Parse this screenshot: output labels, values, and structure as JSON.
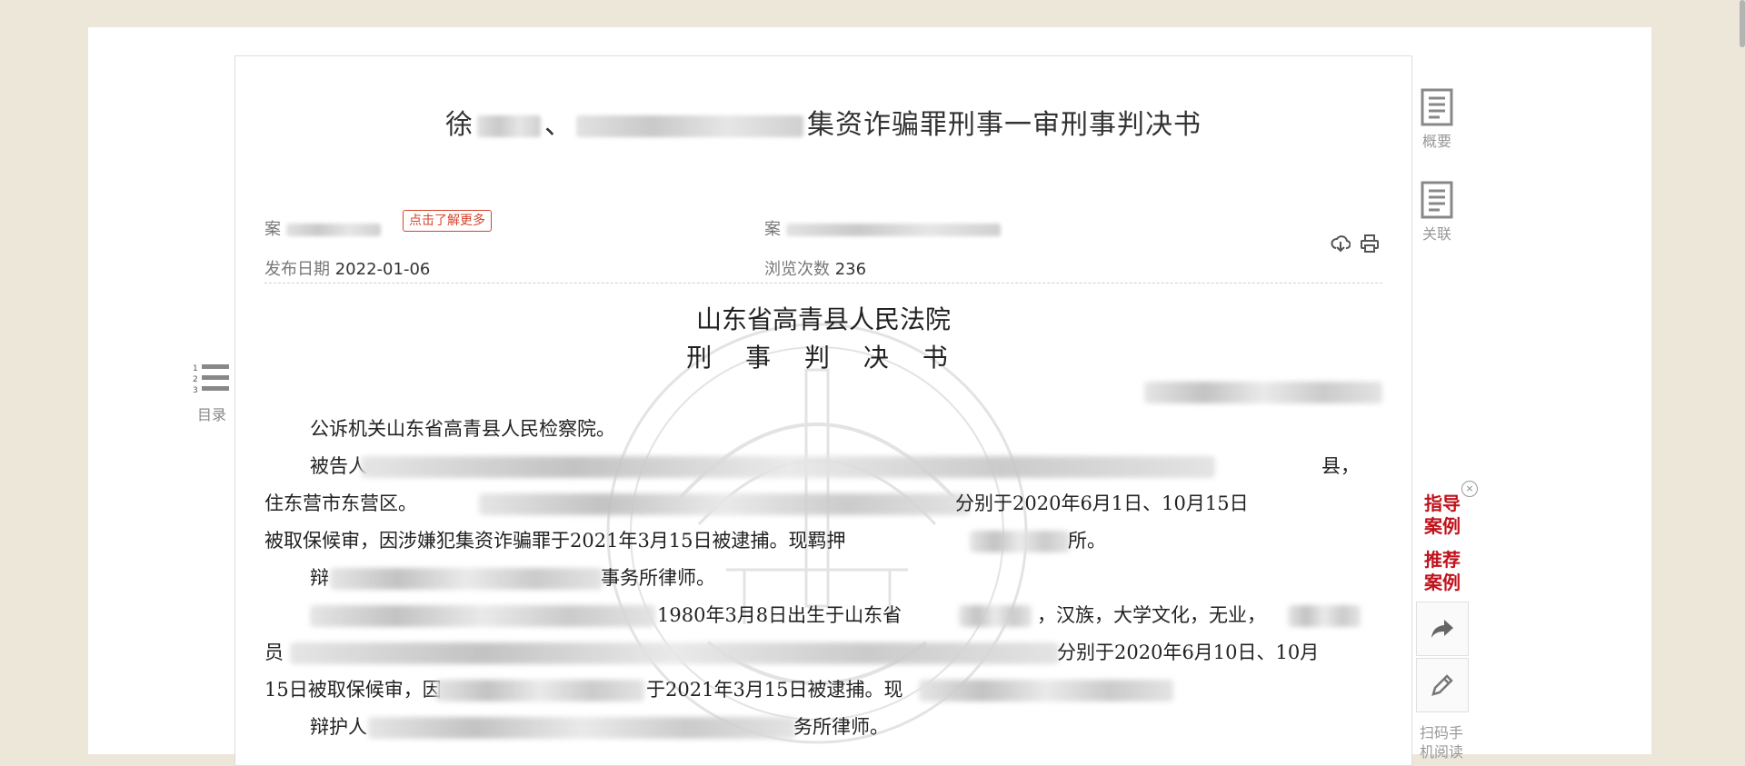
{
  "document": {
    "title_parts": [
      "徐",
      "、",
      "集资诈骗罪刑事一审刑事判决书"
    ],
    "meta": {
      "case_reason_label": "案",
      "more_badge": "点击了解更多",
      "case_number_label": "案",
      "publish_date_label": "发布日期",
      "publish_date": "2022-01-06",
      "views_label": "浏览次数",
      "views": "236"
    },
    "court": "山东省高青县人民法院",
    "doc_type": "刑 事 判 决 书"
  },
  "body": {
    "p1": "公诉机关山东省高青县人民检察院。",
    "p2_start": "被告人",
    "p2_end": "县，",
    "p3_start": "住东营市东营区。",
    "p3_end": "分别于2020年6月1日、10月15日",
    "p4_start": "被取保候审，因涉嫌犯集资诈骗罪于2021年3月15日被逮捕。现羁押",
    "p4_end": "所。",
    "p5_start": "辩",
    "p5_end": "事务所律师。",
    "p6_mid": "1980年3月8日出生于山东省",
    "p6_end": "，汉族，大学文化，无业，",
    "p7_start": "员",
    "p7_end": "分别于2020年6月10日、10月",
    "p8_start": "15日被取保候审，因",
    "p8_mid": "于2021年3月15日被逮捕。现",
    "p9_start": "辩护人",
    "p9_end": "务所律师。"
  },
  "side": {
    "toc_label": "目录",
    "toc_nums": [
      "1",
      "2",
      "3"
    ],
    "summary_label": "概要",
    "related_label": "关联",
    "guide_case": [
      "指导",
      "案例"
    ],
    "recommend_case": [
      "推荐",
      "案例"
    ],
    "close_glyph": "×",
    "scan_label": [
      "扫码手",
      "机阅读"
    ]
  },
  "icons": [
    "download-icon",
    "print-icon",
    "summary-icon",
    "related-icon",
    "share-icon",
    "edit-icon",
    "toc-icon",
    "close-icon"
  ],
  "colors": {
    "accent_red": "#c0121b",
    "badge_red": "#d8442d",
    "page_bg": "#ede7da"
  }
}
